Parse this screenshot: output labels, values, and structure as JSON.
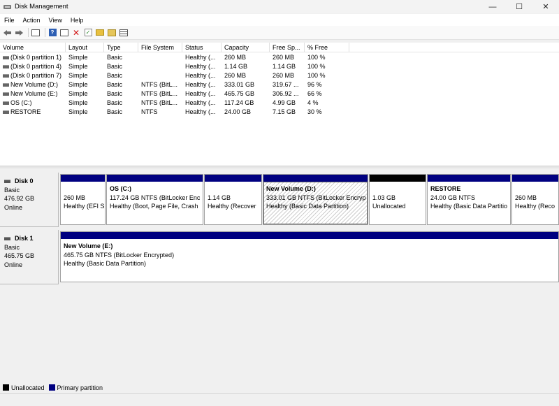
{
  "window": {
    "title": "Disk Management",
    "min_glyph": "—",
    "max_glyph": "☐",
    "close_glyph": "✕"
  },
  "menu": [
    "File",
    "Action",
    "View",
    "Help"
  ],
  "toolbar": {
    "icons": [
      "back-arrow-icon",
      "forward-arrow-icon",
      "properties-icon",
      "help-icon",
      "connect-icon",
      "delete-icon",
      "check-icon",
      "import-icon",
      "folder-icon",
      "list-icon"
    ]
  },
  "volume_list": {
    "columns": [
      "Volume",
      "Layout",
      "Type",
      "File System",
      "Status",
      "Capacity",
      "Free Sp...",
      "% Free"
    ],
    "rows": [
      [
        "(Disk 0 partition 1)",
        "Simple",
        "Basic",
        "",
        "Healthy (...",
        "260 MB",
        "260 MB",
        "100 %"
      ],
      [
        "(Disk 0 partition 4)",
        "Simple",
        "Basic",
        "",
        "Healthy (...",
        "1.14 GB",
        "1.14 GB",
        "100 %"
      ],
      [
        "(Disk 0 partition 7)",
        "Simple",
        "Basic",
        "",
        "Healthy (...",
        "260 MB",
        "260 MB",
        "100 %"
      ],
      [
        "New Volume (D:)",
        "Simple",
        "Basic",
        "NTFS (BitL...",
        "Healthy (...",
        "333.01 GB",
        "319.67 ...",
        "96 %"
      ],
      [
        "New Volume (E:)",
        "Simple",
        "Basic",
        "NTFS (BitL...",
        "Healthy (...",
        "465.75 GB",
        "306.92 ...",
        "66 %"
      ],
      [
        "OS (C:)",
        "Simple",
        "Basic",
        "NTFS (BitL...",
        "Healthy (...",
        "117.24 GB",
        "4.99 GB",
        "4 %"
      ],
      [
        "RESTORE",
        "Simple",
        "Basic",
        "NTFS",
        "Healthy (...",
        "24.00 GB",
        "7.15 GB",
        "30 %"
      ]
    ]
  },
  "disks": [
    {
      "name": "Disk 0",
      "type": "Basic",
      "size": "476.92 GB",
      "status": "Online",
      "partitions": [
        {
          "name": "",
          "line1": "260 MB",
          "line2": "Healthy (EFI S",
          "kind": "primary",
          "selected": false
        },
        {
          "name": "OS  (C:)",
          "line1": "117.24 GB NTFS (BitLocker Enc",
          "line2": "Healthy (Boot, Page File, Crash",
          "kind": "primary",
          "selected": false
        },
        {
          "name": "",
          "line1": "1.14 GB",
          "line2": "Healthy (Recover",
          "kind": "primary",
          "selected": false
        },
        {
          "name": "New Volume  (D:)",
          "line1": "333.01 GB NTFS (BitLocker Encryp",
          "line2": "Healthy (Basic Data Partition)",
          "kind": "primary",
          "selected": true
        },
        {
          "name": "",
          "line1": "1.03 GB",
          "line2": "Unallocated",
          "kind": "unallocated",
          "selected": false
        },
        {
          "name": "RESTORE",
          "line1": "24.00 GB NTFS",
          "line2": "Healthy (Basic Data Partitio",
          "kind": "primary",
          "selected": false
        },
        {
          "name": "",
          "line1": "260 MB",
          "line2": "Healthy (Reco",
          "kind": "primary",
          "selected": false
        }
      ]
    },
    {
      "name": "Disk 1",
      "type": "Basic",
      "size": "465.75 GB",
      "status": "Online",
      "partitions": [
        {
          "name": "New Volume  (E:)",
          "line1": "465.75 GB NTFS (BitLocker Encrypted)",
          "line2": "Healthy (Basic Data Partition)",
          "kind": "primary",
          "selected": false
        }
      ]
    }
  ],
  "legend": [
    {
      "label": "Unallocated",
      "color": "#000000"
    },
    {
      "label": "Primary partition",
      "color": "#000080"
    }
  ]
}
